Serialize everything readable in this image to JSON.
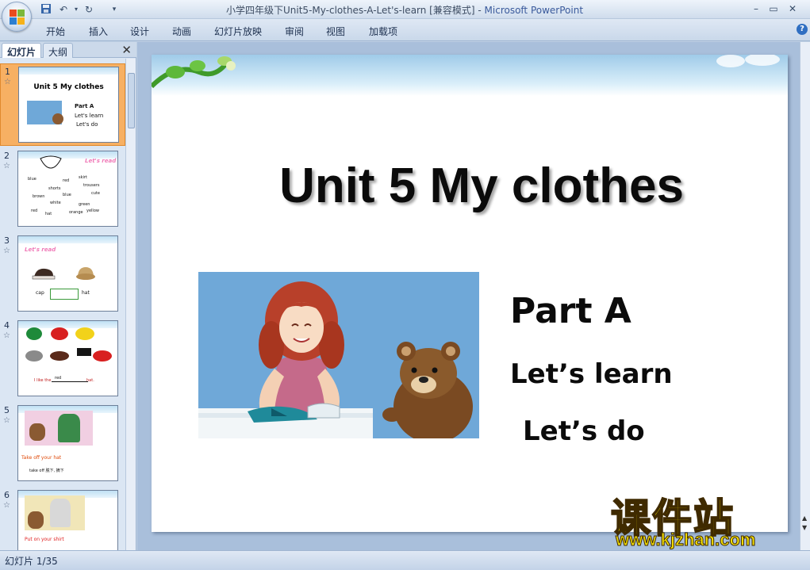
{
  "window": {
    "title": "小学四年级下Unit5-My-clothes-A-Let's-learn [兼容模式]",
    "separator": " - ",
    "app_name": "Microsoft PowerPoint"
  },
  "quick_access": {
    "save_icon": "save-icon",
    "undo_icon": "undo-icon",
    "redo_icon": "redo-icon",
    "customize_icon": "dropdown-icon"
  },
  "window_controls": {
    "minimize": "–",
    "restore": "▭",
    "close": "✕"
  },
  "ribbon": {
    "tabs": [
      "开始",
      "插入",
      "设计",
      "动画",
      "幻灯片放映",
      "审阅",
      "视图",
      "加载项"
    ]
  },
  "left_panel": {
    "tabs": [
      "幻灯片",
      "大纲"
    ],
    "close": "✕",
    "slides": [
      {
        "number": "1",
        "title": "Unit 5 My clothes",
        "lines": [
          "Part A",
          "Let's learn",
          "Let's  do"
        ]
      },
      {
        "number": "2",
        "heading": "Let's read",
        "words": [
          "blue",
          "red",
          "shorts",
          "brown",
          "white",
          "red",
          "hat",
          "blue",
          "green",
          "orange",
          "yellow",
          "skirt",
          "trousers",
          "cute"
        ]
      },
      {
        "number": "3",
        "heading": "Let's read",
        "words": [
          "cap",
          "hat"
        ]
      },
      {
        "number": "4",
        "words": [
          "I like the",
          "red",
          "hat."
        ]
      },
      {
        "number": "5",
        "lines": [
          "Take off your hat",
          "take off 脱下, 摘下"
        ]
      },
      {
        "number": "6",
        "lines": [
          "Put on your shirt"
        ]
      }
    ]
  },
  "slide": {
    "title": "Unit 5 My clothes",
    "part": "Part A",
    "learn": "Let’s learn",
    "do": "Let’s   do"
  },
  "watermark": {
    "cn": "课件站",
    "url": "www.kjzhan.com"
  },
  "status": {
    "slide_counter": "幻灯片 1/35"
  },
  "colors": {
    "accent": "#f7b063",
    "ribbon": "#c9d8ea",
    "workspace": "#a9bfdb",
    "watermark": "#f5e000"
  }
}
